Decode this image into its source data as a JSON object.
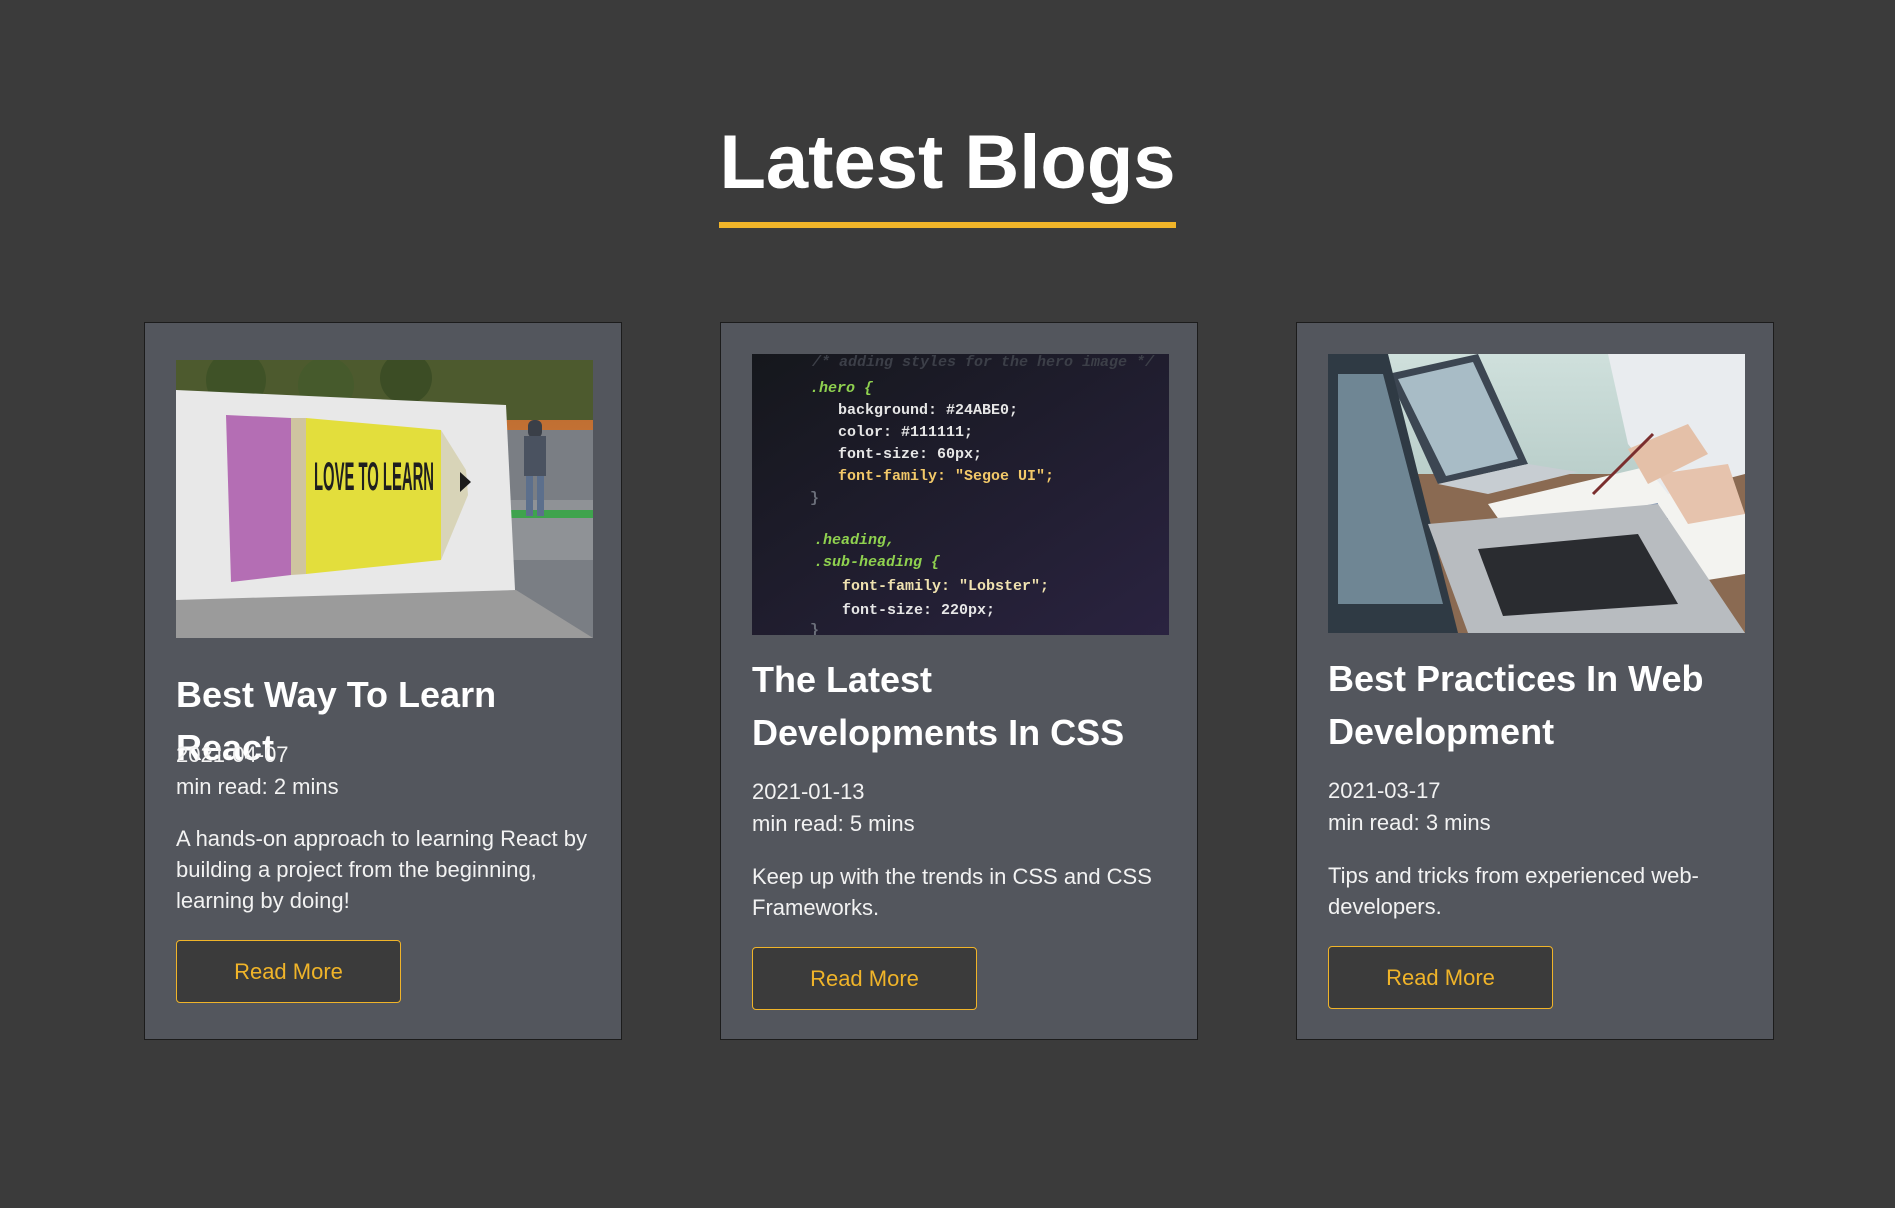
{
  "section": {
    "title": "Latest Blogs",
    "accent_color": "#f0b429"
  },
  "posts": [
    {
      "image": "pencil-sign-love-to-learn-photo",
      "image_text": "LOVE TO LEARN",
      "title": "Best Way To Learn React",
      "date": "2021-04-07",
      "read_time": "min read: 2 mins",
      "excerpt": "A hands-on approach to learning React by building a project from the beginning, learning by doing!",
      "button_label": "Read More"
    },
    {
      "image": "css-code-screen-photo",
      "image_text": [
        "/* adding styles for the hero image */",
        ".hero {",
        "background: #24ABE0;",
        "color: #111111;",
        "font-size: 60px;",
        "font-family: \"Segoe UI\";",
        "}",
        ".heading,",
        ".sub-heading {",
        "font-family: \"Lobster\";",
        "font-size: 220px;",
        "}"
      ],
      "title": "The Latest Developments In CSS",
      "date": "2021-01-13",
      "read_time": "min read: 5 mins",
      "excerpt": "Keep up with the trends in CSS and CSS Frameworks.",
      "button_label": "Read More"
    },
    {
      "image": "laptops-meeting-notes-photo",
      "title": "Best Practices In Web Development",
      "date": "2021-03-17",
      "read_time": "min read: 3 mins",
      "excerpt": "Tips and tricks from experienced web-developers.",
      "button_label": "Read More"
    }
  ]
}
